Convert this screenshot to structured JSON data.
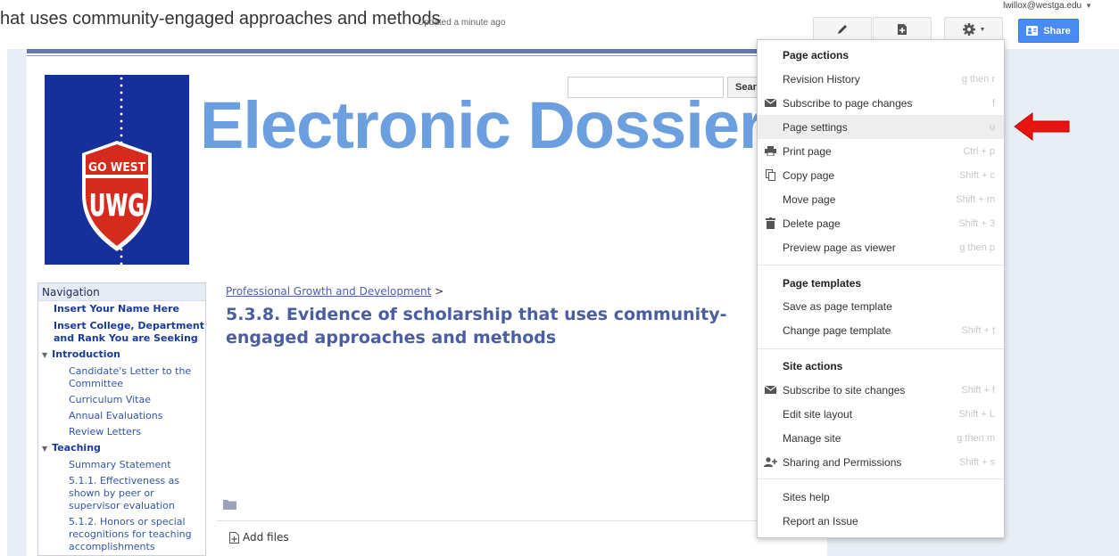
{
  "header": {
    "page_title": "hat uses community-engaged approaches and methods",
    "updated": "Updated a minute ago",
    "user_email": "lwillox@westga.edu",
    "share_label": "Share"
  },
  "site": {
    "banner_title": "Electronic Dossier",
    "search_button_label": "Search",
    "logo_text_top": "GO WEST",
    "logo_text_bottom": "UWG"
  },
  "navigation": {
    "header": "Navigation",
    "items": [
      {
        "label": "Insert Your Name Here"
      },
      {
        "label": "Insert College, Department and Rank You are Seeking"
      },
      {
        "label": "Introduction"
      },
      {
        "label": "Candidate's Letter to the Committee"
      },
      {
        "label": "Curriculum Vitae"
      },
      {
        "label": "Annual Evaluations"
      },
      {
        "label": "Review Letters"
      },
      {
        "label": "Teaching"
      },
      {
        "label": "Summary Statement"
      },
      {
        "label": "5.1.1. Effectiveness as shown by peer or supervisor evaluation"
      },
      {
        "label": "5.1.2. Honors or special recognitions for teaching accomplishments"
      }
    ]
  },
  "main": {
    "breadcrumb_link": "Professional Growth and Development",
    "breadcrumb_sep": " >",
    "heading": "5.3.8. Evidence of scholarship that uses community-engaged approaches and methods",
    "add_files": "Add files"
  },
  "menu": {
    "page_actions_header": "Page actions",
    "page_actions": [
      {
        "label": "Revision History",
        "shortcut": "g then r",
        "icon": "none"
      },
      {
        "label": "Subscribe to page changes",
        "shortcut": "f",
        "icon": "envelope-icon"
      },
      {
        "label": "Page settings",
        "shortcut": "u",
        "icon": "none"
      },
      {
        "label": "Print page",
        "shortcut": "Ctrl + p",
        "icon": "print-icon"
      },
      {
        "label": "Copy page",
        "shortcut": "Shift + c",
        "icon": "copy-icon"
      },
      {
        "label": "Move page",
        "shortcut": "Shift + m",
        "icon": "none"
      },
      {
        "label": "Delete page",
        "shortcut": "Shift + 3",
        "icon": "trash-icon"
      },
      {
        "label": "Preview page as viewer",
        "shortcut": "g then p",
        "icon": "none"
      }
    ],
    "page_templates_header": "Page templates",
    "page_templates": [
      {
        "label": "Save as page template",
        "shortcut": ""
      },
      {
        "label": "Change page template",
        "shortcut": "Shift + t"
      }
    ],
    "site_actions_header": "Site actions",
    "site_actions": [
      {
        "label": "Subscribe to site changes",
        "shortcut": "Shift + f",
        "icon": "envelope-icon"
      },
      {
        "label": "Edit site layout",
        "shortcut": "Shift + L",
        "icon": "none"
      },
      {
        "label": "Manage site",
        "shortcut": "g then m",
        "icon": "none"
      },
      {
        "label": "Sharing and Permissions",
        "shortcut": "Shift + s",
        "icon": "add-person-icon"
      }
    ],
    "help": [
      {
        "label": "Sites help"
      },
      {
        "label": "Report an Issue"
      }
    ]
  },
  "colors": {
    "accent": "#4a8af4",
    "banner": "#6b9fe0",
    "heading": "#4a5ea0",
    "logo_blue": "#15309a",
    "logo_red": "#d52b1e",
    "arrow_red": "#e8140f"
  }
}
